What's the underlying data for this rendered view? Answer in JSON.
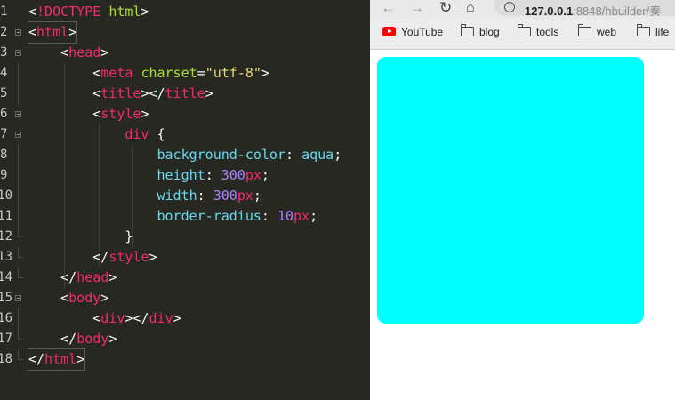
{
  "editor": {
    "lines": [
      {
        "n": "1",
        "tokens": [
          [
            "p",
            "<"
          ],
          [
            "t",
            "!DOCTYPE"
          ],
          [
            "p",
            " "
          ],
          [
            "a",
            "html"
          ],
          [
            "p",
            ">"
          ]
        ]
      },
      {
        "n": "2",
        "tokens": [
          [
            "p",
            "<"
          ],
          [
            "t",
            "html"
          ],
          [
            "p",
            ">"
          ]
        ]
      },
      {
        "n": "3",
        "tokens": [
          [
            "p",
            "    <"
          ],
          [
            "t",
            "head"
          ],
          [
            "p",
            ">"
          ]
        ]
      },
      {
        "n": "4",
        "tokens": [
          [
            "p",
            "        <"
          ],
          [
            "t",
            "meta"
          ],
          [
            "p",
            " "
          ],
          [
            "a",
            "charset"
          ],
          [
            "p",
            "="
          ],
          [
            "s",
            "\"utf-8\""
          ],
          [
            "p",
            ">"
          ]
        ]
      },
      {
        "n": "5",
        "tokens": [
          [
            "p",
            "        <"
          ],
          [
            "t",
            "title"
          ],
          [
            "p",
            "></"
          ],
          [
            "t",
            "title"
          ],
          [
            "p",
            ">"
          ]
        ]
      },
      {
        "n": "6",
        "tokens": [
          [
            "p",
            "        <"
          ],
          [
            "t",
            "style"
          ],
          [
            "p",
            ">"
          ]
        ]
      },
      {
        "n": "7",
        "tokens": [
          [
            "p",
            "            "
          ],
          [
            "t",
            "div"
          ],
          [
            "p",
            " {"
          ]
        ]
      },
      {
        "n": "8",
        "tokens": [
          [
            "p",
            "                "
          ],
          [
            "pr",
            "background-color"
          ],
          [
            "p",
            ": "
          ],
          [
            "pr",
            "aqua"
          ],
          [
            "p",
            ";"
          ]
        ]
      },
      {
        "n": "9",
        "tokens": [
          [
            "p",
            "                "
          ],
          [
            "pr",
            "height"
          ],
          [
            "p",
            ": "
          ],
          [
            "n",
            "300"
          ],
          [
            "u",
            "px"
          ],
          [
            "p",
            ";"
          ]
        ]
      },
      {
        "n": "10",
        "tokens": [
          [
            "p",
            "                "
          ],
          [
            "pr",
            "width"
          ],
          [
            "p",
            ": "
          ],
          [
            "n",
            "300"
          ],
          [
            "u",
            "px"
          ],
          [
            "p",
            ";"
          ]
        ]
      },
      {
        "n": "11",
        "tokens": [
          [
            "p",
            "                "
          ],
          [
            "pr",
            "border-radius"
          ],
          [
            "p",
            ": "
          ],
          [
            "n",
            "10"
          ],
          [
            "u",
            "px"
          ],
          [
            "p",
            ";"
          ]
        ]
      },
      {
        "n": "12",
        "tokens": [
          [
            "p",
            "            }"
          ]
        ]
      },
      {
        "n": "13",
        "tokens": [
          [
            "p",
            "        </"
          ],
          [
            "t",
            "style"
          ],
          [
            "p",
            ">"
          ]
        ]
      },
      {
        "n": "14",
        "tokens": [
          [
            "p",
            "    </"
          ],
          [
            "t",
            "head"
          ],
          [
            "p",
            ">"
          ]
        ]
      },
      {
        "n": "15",
        "tokens": [
          [
            "p",
            "    <"
          ],
          [
            "t",
            "body"
          ],
          [
            "p",
            ">"
          ]
        ]
      },
      {
        "n": "16",
        "tokens": [
          [
            "p",
            "        <"
          ],
          [
            "t",
            "div"
          ],
          [
            "p",
            "></"
          ],
          [
            "t",
            "div"
          ],
          [
            "p",
            ">"
          ]
        ]
      },
      {
        "n": "17",
        "tokens": [
          [
            "p",
            "    </"
          ],
          [
            "t",
            "body"
          ],
          [
            "p",
            ">"
          ]
        ]
      },
      {
        "n": "18",
        "tokens": [
          [
            "p",
            "</"
          ],
          [
            "t",
            "html"
          ],
          [
            "p",
            ">"
          ]
        ]
      }
    ],
    "fold_markers": [
      2,
      3,
      6,
      7,
      15
    ],
    "fold_ends": [
      12,
      13,
      14,
      17,
      18
    ],
    "boxed_lines": [
      2,
      18
    ]
  },
  "browser": {
    "nav": {
      "back_icon": "arrow-left-icon",
      "forward_icon": "arrow-right-icon",
      "reload_icon": "reload-icon",
      "home_icon": "home-icon"
    },
    "url": {
      "host": "127.0.0.1",
      "rest": ":8848/hbuilder/秦"
    },
    "bookmarks": [
      {
        "label": "YouTube",
        "icon": "youtube-icon"
      },
      {
        "label": "blog",
        "icon": "folder-icon"
      },
      {
        "label": "tools",
        "icon": "folder-icon"
      },
      {
        "label": "web",
        "icon": "folder-icon"
      },
      {
        "label": "life",
        "icon": "folder-icon"
      }
    ],
    "render": {
      "background_color": "#00ffff"
    }
  }
}
